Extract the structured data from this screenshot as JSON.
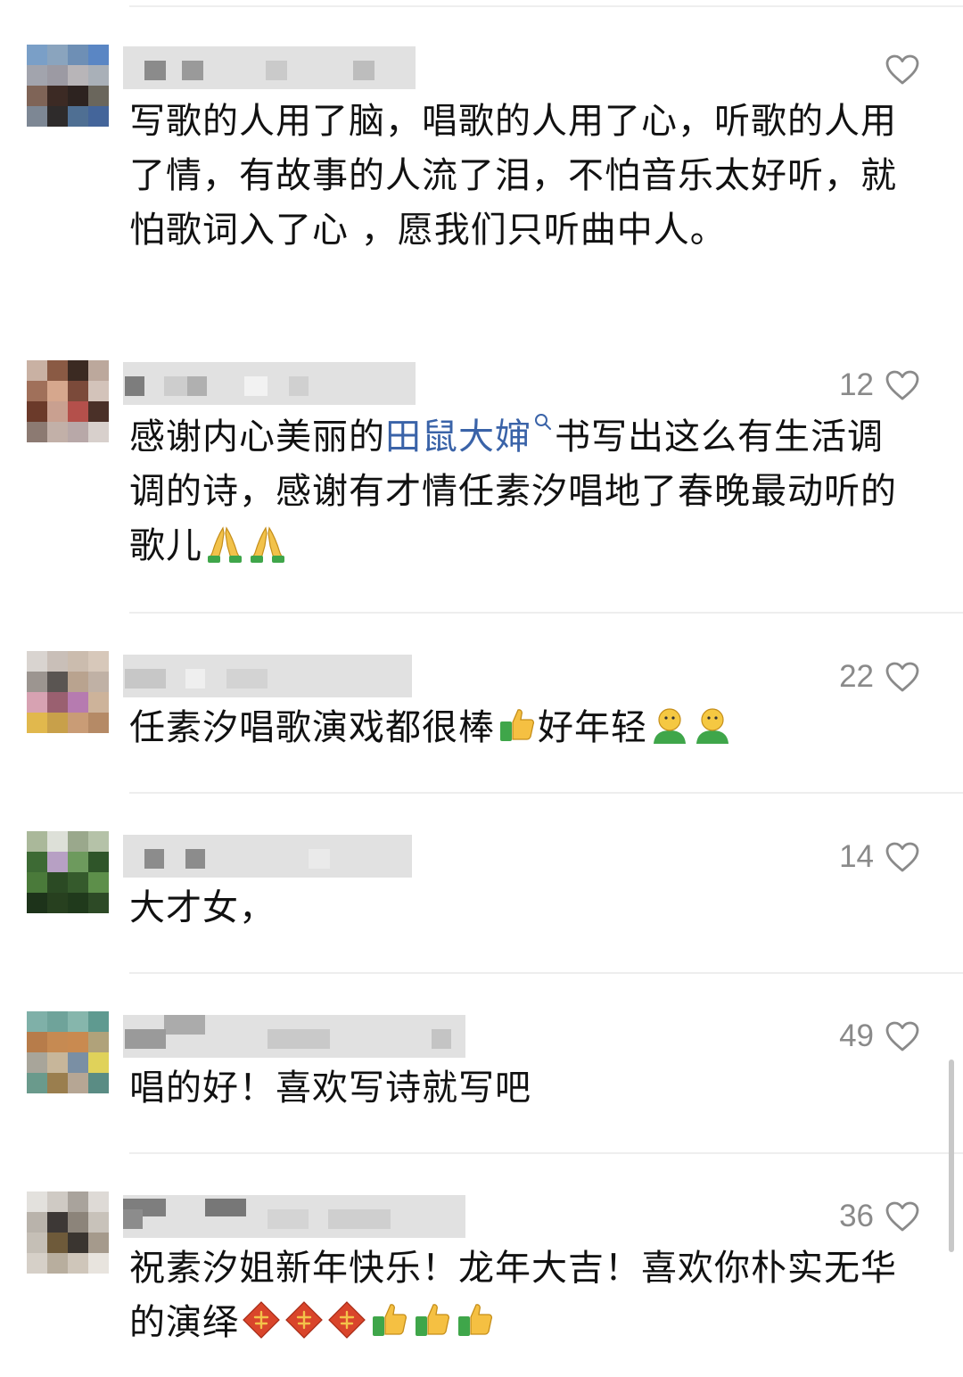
{
  "colors": {
    "text": "#111111",
    "muted": "#8a8a8a",
    "mention": "#3a63a8",
    "divider": "#eeeeee"
  },
  "comments": [
    {
      "likes": "",
      "segments": [
        {
          "type": "text",
          "value": "写歌的人用了脑，唱歌的人用了心，听歌的人用了情，有故事的人流了泪，不怕音乐太好听，就怕歌词入了心 ，愿我们只听曲中人。"
        }
      ]
    },
    {
      "likes": "12",
      "segments": [
        {
          "type": "text",
          "value": "感谢内心美丽的"
        },
        {
          "type": "mention",
          "value": "田鼠大婶"
        },
        {
          "type": "text",
          "value": "书写出这么有生活调调的诗，感谢有才情任素汐唱地了春晚最动听的歌儿"
        },
        {
          "type": "emoji",
          "icon": "folded-hands-icon",
          "count": 2
        }
      ]
    },
    {
      "likes": "22",
      "segments": [
        {
          "type": "text",
          "value": "任素汐唱歌演戏都很棒"
        },
        {
          "type": "emoji",
          "icon": "thumbs-up-icon",
          "count": 1
        },
        {
          "type": "text",
          "value": "好年轻"
        },
        {
          "type": "emoji",
          "icon": "smiley-figure-icon",
          "count": 2
        }
      ]
    },
    {
      "likes": "14",
      "segments": [
        {
          "type": "text",
          "value": "大才女，"
        }
      ]
    },
    {
      "likes": "49",
      "segments": [
        {
          "type": "text",
          "value": "唱的好！喜欢写诗就写吧"
        }
      ]
    },
    {
      "likes": "36",
      "segments": [
        {
          "type": "text",
          "value": "祝素汐姐新年快乐！龙年大吉！喜欢你朴实无华的演绎"
        },
        {
          "type": "emoji",
          "icon": "fu-blessing-icon",
          "count": 3
        },
        {
          "type": "emoji",
          "icon": "thumbs-up-icon",
          "count": 3
        }
      ]
    }
  ]
}
